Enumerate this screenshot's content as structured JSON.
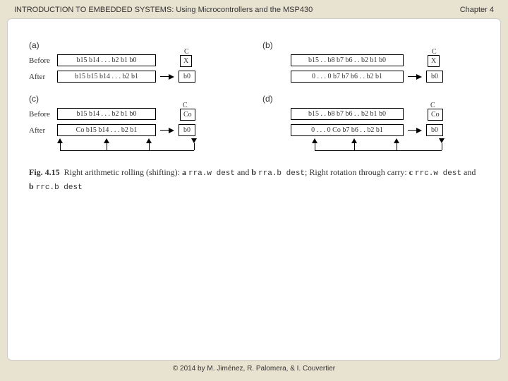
{
  "header": {
    "title": "INTRODUCTION TO EMBEDDED SYSTEMS: Using Microcontrollers and the MSP430",
    "chapter": "Chapter 4"
  },
  "footer": "© 2014 by M. Jiménez, R. Palomera, & I. Couvertier",
  "panels": {
    "a": {
      "label": "(a)",
      "before_label": "Before",
      "after_label": "After",
      "c_label": "C",
      "before_bits": "b15  b14  .  .  .  b2  b1  b0",
      "before_c": "X",
      "after_bits": "b15  b15  b14  .  .  .  b2  b1",
      "after_c": "b0"
    },
    "b": {
      "label": "(b)",
      "c_label": "C",
      "before_bits": "b15 . . b8  b7  b6 . . b2 b1 b0",
      "before_c": "X",
      "after_bits": "0 . . . 0  b7  b7  b6 . . b2 b1",
      "after_c": "b0"
    },
    "c": {
      "label": "(c)",
      "before_label": "Before",
      "after_label": "After",
      "c_label": "C",
      "before_bits": "b15  b14  .  .  .  b2  b1  b0",
      "before_c": "Co",
      "after_bits": "Co  b15  b14  .  .  .  b2  b1",
      "after_c": "b0"
    },
    "d": {
      "label": "(d)",
      "c_label": "C",
      "before_bits": "b15 . . b8  b7  b6 . . b2 b1 b0",
      "before_c": "Co",
      "after_bits": "0 . . . 0  Co  b7  b6 . . b2 b1",
      "after_c": "b0"
    }
  },
  "caption": {
    "fig": "Fig. 4.15",
    "t1": "Right arithmetic rolling (shifting): ",
    "aop": "a ",
    "c1": "rra.w dest",
    "t2": " and ",
    "bop": "b ",
    "c2": "rra.b dest",
    "t3": "; Right rotation through carry: ",
    "cop": "c ",
    "c3": "rrc.w dest",
    "t4": " and ",
    "bop2": "b ",
    "c4": "rrc.b dest"
  }
}
